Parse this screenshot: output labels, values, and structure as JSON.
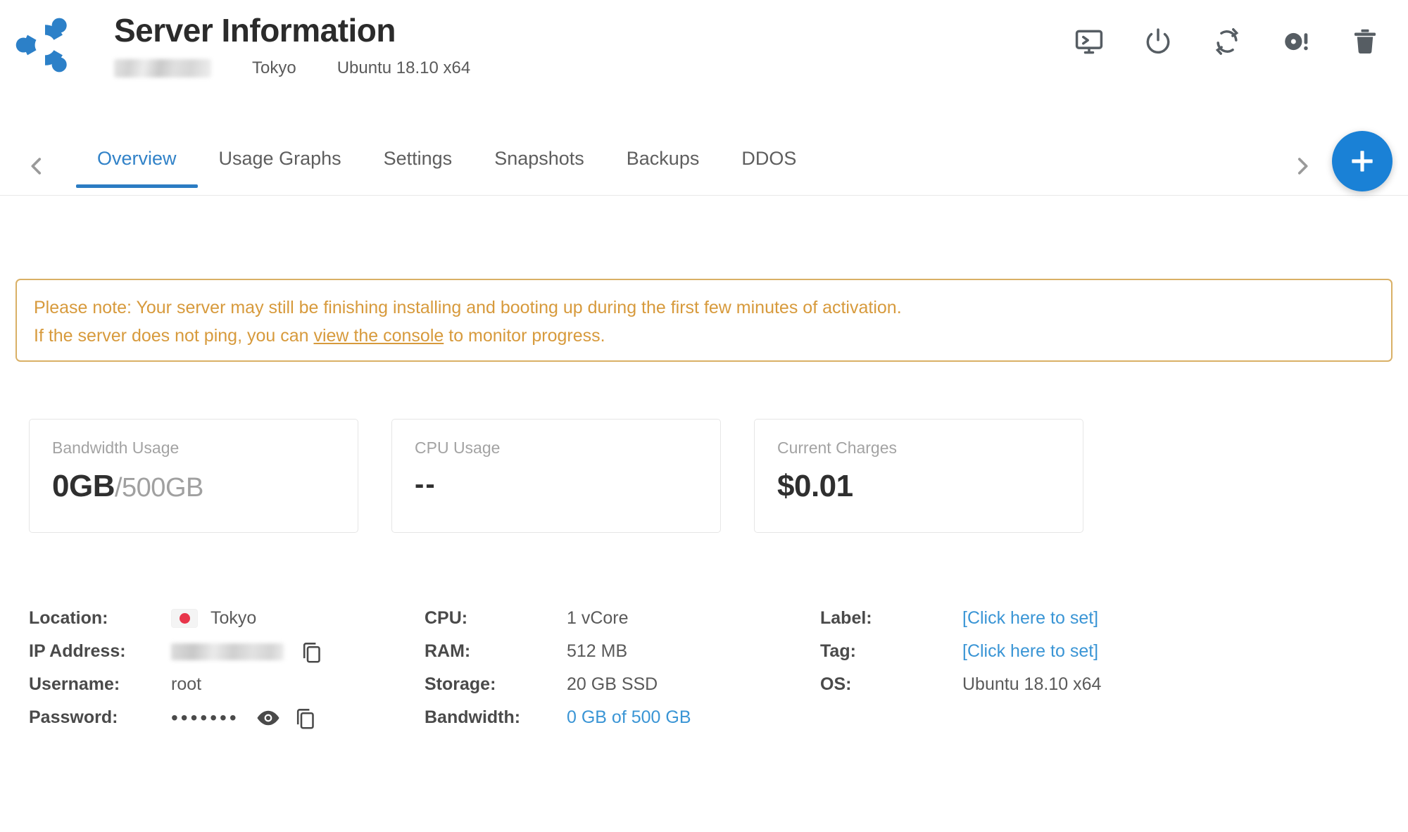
{
  "header": {
    "title": "Server Information",
    "logo_icon": "ubuntu-logo-icon",
    "hostname_redacted": "",
    "location": "Tokyo",
    "os": "Ubuntu 18.10 x64",
    "actions": [
      {
        "name": "console-icon",
        "label": "View Console"
      },
      {
        "name": "power-icon",
        "label": "Power"
      },
      {
        "name": "restart-icon",
        "label": "Restart"
      },
      {
        "name": "reinstall-icon",
        "label": "Reinstall"
      },
      {
        "name": "trash-icon",
        "label": "Destroy"
      }
    ]
  },
  "tabs": {
    "prev_arrow": "chevron-left-icon",
    "next_arrow": "chevron-right-icon",
    "items": [
      {
        "label": "Overview",
        "active": true
      },
      {
        "label": "Usage Graphs",
        "active": false
      },
      {
        "label": "Settings",
        "active": false
      },
      {
        "label": "Snapshots",
        "active": false
      },
      {
        "label": "Backups",
        "active": false
      },
      {
        "label": "DDOS",
        "active": false
      }
    ]
  },
  "fab": {
    "icon": "plus-icon",
    "label": "+"
  },
  "notice": {
    "line1": "Please note: Your server may still be finishing installing and booting up during the first few minutes of activation.",
    "line2_before": "If the server does not ping, you can ",
    "line2_link": "view the console",
    "line2_after": " to monitor progress.",
    "border_color": "#d9b066",
    "text_color": "#d79a3c"
  },
  "cards": [
    {
      "label": "Bandwidth Usage",
      "value": "0GB",
      "value_muted": "/500GB"
    },
    {
      "label": "CPU Usage",
      "value": "--",
      "value_muted": ""
    },
    {
      "label": "Current Charges",
      "value": "$0.01",
      "value_muted": ""
    }
  ],
  "details": {
    "col1": [
      {
        "key": "Location:",
        "value": "Tokyo",
        "type": "flag"
      },
      {
        "key": "IP Address:",
        "value": "",
        "type": "blur-copy"
      },
      {
        "key": "Username:",
        "value": "root",
        "type": "text"
      },
      {
        "key": "Password:",
        "value": "•••••••",
        "type": "password"
      }
    ],
    "col2": [
      {
        "key": "CPU:",
        "value": "1 vCore",
        "type": "text"
      },
      {
        "key": "RAM:",
        "value": "512 MB",
        "type": "text"
      },
      {
        "key": "Storage:",
        "value": "20 GB SSD",
        "type": "text"
      },
      {
        "key": "Bandwidth:",
        "value": "0 GB of 500 GB",
        "type": "link"
      }
    ],
    "col3": [
      {
        "key": "Label:",
        "value": "[Click here to set]",
        "type": "link"
      },
      {
        "key": "Tag:",
        "value": "[Click here to set]",
        "type": "link"
      },
      {
        "key": "OS:",
        "value": "Ubuntu 18.10 x64",
        "type": "text"
      }
    ]
  },
  "colors": {
    "accent_blue": "#3182c8",
    "link_blue": "#3a95d5",
    "fab_blue": "#1a81d6",
    "notice_amber": "#d79a3c",
    "logo_blue": "#2c80c8"
  }
}
